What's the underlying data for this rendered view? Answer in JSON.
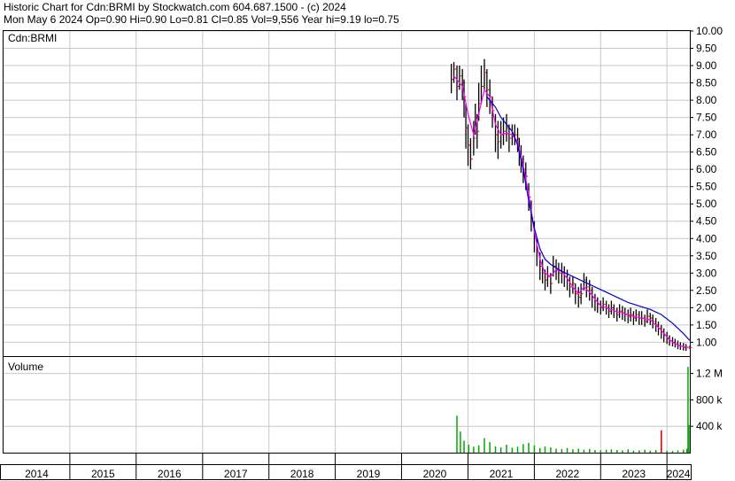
{
  "header": {
    "line1": "Historic Chart for Cdn:BRMI by Stockwatch.com 604.687.1500 - (c) 2024",
    "line2": "Mon May  6 2024  Op=0.90  Hi=0.90  Lo=0.81  Cl=0.85  Vol=9,556  Year hi=9.19  lo=0.75"
  },
  "colors": {
    "price": "#000000",
    "ma_short": "#ff00ff",
    "ma_long": "#0000cc",
    "close_marks": "#ff0000",
    "volume": "#00aa00",
    "volume_spike": "#cc0000",
    "grid": "#c8c8c8"
  },
  "chart_data": [
    {
      "type": "line",
      "title": "Cdn:BRMI",
      "y_tick_labels": [
        "10.00",
        "9.50",
        "9.00",
        "8.50",
        "8.00",
        "7.50",
        "7.00",
        "6.50",
        "6.00",
        "5.50",
        "5.00",
        "4.50",
        "4.00",
        "3.50",
        "3.00",
        "2.50",
        "2.00",
        "1.50",
        "1.00"
      ],
      "ylim": [
        0.6,
        10.0
      ],
      "x_tick_labels": [
        "2014",
        "2015",
        "2016",
        "2017",
        "2018",
        "2019",
        "2020",
        "2021",
        "2022",
        "2023",
        "2024"
      ],
      "xlim": [
        "2014-01-01",
        "2024-05-06"
      ],
      "grid": true,
      "series": [
        {
          "key": "price",
          "x": [
            "2020-10-01",
            "2020-10-15",
            "2020-11-01",
            "2020-11-15",
            "2020-12-01",
            "2020-12-10",
            "2020-12-20",
            "2021-01-01",
            "2021-01-15",
            "2021-02-01",
            "2021-02-10",
            "2021-02-20",
            "2021-03-01",
            "2021-03-15",
            "2021-04-01",
            "2021-04-15",
            "2021-05-01",
            "2021-05-15",
            "2021-06-01",
            "2021-06-15",
            "2021-07-01",
            "2021-07-15",
            "2021-08-01",
            "2021-08-15",
            "2021-09-01",
            "2021-09-15",
            "2021-10-01",
            "2021-10-10",
            "2021-10-20",
            "2021-11-01",
            "2021-11-15",
            "2021-12-01",
            "2021-12-15",
            "2022-01-01",
            "2022-01-15",
            "2022-02-01",
            "2022-02-15",
            "2022-03-01",
            "2022-03-15",
            "2022-04-01",
            "2022-04-15",
            "2022-05-01",
            "2022-05-15",
            "2022-06-01",
            "2022-06-15",
            "2022-07-01",
            "2022-07-15",
            "2022-08-01",
            "2022-08-15",
            "2022-09-01",
            "2022-09-15",
            "2022-10-01",
            "2022-10-15",
            "2022-11-01",
            "2022-11-15",
            "2022-12-01",
            "2022-12-15",
            "2023-01-01",
            "2023-01-15",
            "2023-02-01",
            "2023-02-15",
            "2023-03-01",
            "2023-03-15",
            "2023-04-01",
            "2023-04-15",
            "2023-05-01",
            "2023-05-15",
            "2023-06-01",
            "2023-06-15",
            "2023-07-01",
            "2023-07-15",
            "2023-08-01",
            "2023-08-15",
            "2023-09-01",
            "2023-09-15",
            "2023-10-01",
            "2023-10-15",
            "2023-11-01",
            "2023-11-15",
            "2023-12-01",
            "2023-12-15",
            "2024-01-01",
            "2024-01-15",
            "2024-02-01",
            "2024-02-15",
            "2024-03-01",
            "2024-03-15",
            "2024-04-01",
            "2024-04-15",
            "2024-05-06"
          ],
          "close": [
            8.6,
            8.9,
            8.4,
            8.7,
            8.5,
            8.1,
            7.2,
            6.7,
            6.3,
            6.9,
            7.5,
            7.1,
            7.9,
            8.4,
            8.8,
            8.3,
            8.1,
            7.7,
            7.0,
            6.8,
            7.0,
            7.1,
            7.2,
            6.9,
            7.0,
            7.0,
            6.9,
            6.5,
            6.3,
            6.0,
            5.8,
            5.2,
            4.6,
            4.0,
            3.6,
            3.2,
            3.0,
            2.8,
            2.9,
            2.7,
            3.2,
            3.1,
            3.0,
            3.0,
            2.9,
            2.8,
            2.6,
            2.7,
            2.4,
            2.3,
            2.4,
            2.8,
            2.6,
            2.5,
            2.3,
            2.2,
            2.1,
            2.0,
            2.1,
            2.0,
            1.9,
            2.0,
            1.9,
            1.8,
            1.9,
            1.85,
            1.8,
            1.75,
            1.8,
            1.7,
            1.8,
            1.7,
            1.7,
            1.6,
            1.75,
            1.7,
            1.6,
            1.5,
            1.4,
            1.3,
            1.2,
            1.1,
            1.05,
            1.0,
            0.95,
            0.9,
            0.88,
            0.85,
            0.85,
            0.85
          ],
          "high": [
            9.05,
            9.1,
            9.0,
            9.0,
            8.9,
            8.6,
            7.9,
            7.3,
            6.9,
            7.4,
            7.9,
            7.6,
            8.5,
            9.0,
            9.19,
            8.9,
            8.6,
            8.1,
            7.6,
            7.4,
            7.4,
            7.5,
            7.6,
            7.3,
            7.3,
            7.3,
            7.2,
            6.9,
            6.7,
            6.4,
            6.2,
            5.6,
            5.1,
            4.5,
            4.0,
            3.6,
            3.4,
            3.1,
            3.2,
            3.0,
            3.5,
            3.4,
            3.3,
            3.3,
            3.2,
            3.1,
            2.9,
            2.9,
            2.7,
            2.6,
            2.7,
            3.0,
            2.9,
            2.8,
            2.6,
            2.4,
            2.3,
            2.2,
            2.3,
            2.2,
            2.1,
            2.2,
            2.1,
            2.0,
            2.1,
            2.05,
            2.0,
            1.95,
            2.0,
            1.9,
            1.95,
            1.9,
            1.9,
            1.8,
            1.95,
            1.85,
            1.8,
            1.7,
            1.6,
            1.5,
            1.4,
            1.3,
            1.2,
            1.15,
            1.1,
            1.05,
            1.0,
            0.98,
            0.95,
            0.9
          ],
          "low": [
            8.2,
            8.5,
            8.0,
            8.3,
            8.0,
            7.5,
            6.6,
            6.1,
            6.0,
            6.4,
            7.0,
            6.6,
            7.4,
            7.9,
            8.3,
            7.8,
            7.6,
            7.2,
            6.5,
            6.3,
            6.6,
            6.7,
            6.8,
            6.5,
            6.7,
            6.7,
            6.5,
            6.1,
            5.9,
            5.6,
            5.4,
            4.8,
            4.2,
            3.6,
            3.2,
            2.8,
            2.7,
            2.5,
            2.6,
            2.4,
            2.9,
            2.8,
            2.7,
            2.7,
            2.6,
            2.5,
            2.3,
            2.4,
            2.1,
            2.0,
            2.1,
            2.5,
            2.3,
            2.2,
            2.0,
            1.9,
            1.85,
            1.8,
            1.9,
            1.8,
            1.7,
            1.8,
            1.7,
            1.6,
            1.7,
            1.65,
            1.6,
            1.55,
            1.6,
            1.5,
            1.6,
            1.5,
            1.5,
            1.45,
            1.55,
            1.5,
            1.4,
            1.3,
            1.2,
            1.1,
            1.0,
            0.95,
            0.9,
            0.88,
            0.85,
            0.8,
            0.78,
            0.76,
            0.75,
            0.81
          ]
        },
        {
          "key": "ma_short",
          "x": [
            "2020-10-15",
            "2020-12-01",
            "2021-01-01",
            "2021-02-01",
            "2021-03-01",
            "2021-04-01",
            "2021-05-01",
            "2021-06-01",
            "2021-07-01",
            "2021-08-01",
            "2021-09-01",
            "2021-10-01",
            "2021-11-01",
            "2021-12-01",
            "2022-01-01",
            "2022-02-01",
            "2022-03-01",
            "2022-04-01",
            "2022-05-01",
            "2022-06-01",
            "2022-07-01",
            "2022-08-01",
            "2022-09-01",
            "2022-10-01",
            "2022-11-01",
            "2022-12-01",
            "2023-01-01",
            "2023-02-01",
            "2023-03-01",
            "2023-04-01",
            "2023-05-01",
            "2023-06-01",
            "2023-07-01",
            "2023-08-01",
            "2023-09-01",
            "2023-10-01",
            "2023-11-01",
            "2023-12-01",
            "2024-01-01",
            "2024-02-01",
            "2024-03-01",
            "2024-04-01",
            "2024-05-06"
          ],
          "values": [
            8.7,
            8.4,
            7.6,
            7.0,
            7.6,
            8.3,
            8.1,
            7.3,
            7.0,
            7.05,
            7.0,
            6.8,
            6.1,
            5.3,
            4.2,
            3.4,
            3.0,
            2.9,
            3.1,
            3.05,
            2.85,
            2.6,
            2.4,
            2.6,
            2.45,
            2.25,
            2.05,
            2.0,
            1.95,
            1.88,
            1.85,
            1.8,
            1.75,
            1.72,
            1.68,
            1.65,
            1.5,
            1.35,
            1.15,
            1.0,
            0.92,
            0.87,
            0.85
          ]
        },
        {
          "key": "ma_long",
          "x": [
            "2021-04-15",
            "2021-06-01",
            "2021-07-01",
            "2021-08-01",
            "2021-09-01",
            "2021-10-01",
            "2021-11-01",
            "2021-12-01",
            "2022-01-01",
            "2022-02-01",
            "2022-03-01",
            "2022-04-01",
            "2022-05-01",
            "2022-06-01",
            "2022-08-01",
            "2022-10-01",
            "2022-12-01",
            "2023-02-01",
            "2023-04-01",
            "2023-06-01",
            "2023-08-01",
            "2023-10-01",
            "2023-12-01",
            "2024-02-01",
            "2024-04-01",
            "2024-05-06"
          ],
          "values": [
            8.1,
            7.8,
            7.5,
            7.3,
            7.1,
            6.7,
            6.0,
            5.1,
            4.3,
            3.7,
            3.4,
            3.25,
            3.15,
            3.05,
            2.9,
            2.75,
            2.6,
            2.45,
            2.3,
            2.15,
            2.05,
            1.95,
            1.8,
            1.55,
            1.25,
            1.05
          ]
        }
      ]
    },
    {
      "type": "bar",
      "title": "Volume",
      "y_tick_labels": [
        "1.2 M",
        "800 k",
        "400 k"
      ],
      "y_ticks": [
        1200000,
        800000,
        400000
      ],
      "ylim": [
        0,
        1450000
      ],
      "x_tick_labels": [
        "2014",
        "2015",
        "2016",
        "2017",
        "2018",
        "2019",
        "2020",
        "2021",
        "2022",
        "2023",
        "2024"
      ],
      "series": [
        {
          "key": "volume",
          "x": [
            "2020-11-01",
            "2020-11-20",
            "2020-12-10",
            "2021-01-05",
            "2021-02-01",
            "2021-03-01",
            "2021-04-01",
            "2021-05-01",
            "2021-06-01",
            "2021-07-01",
            "2021-08-01",
            "2021-09-01",
            "2021-10-01",
            "2021-11-01",
            "2021-12-01",
            "2022-01-01",
            "2022-02-01",
            "2022-03-01",
            "2022-04-01",
            "2022-05-01",
            "2022-06-01",
            "2022-07-01",
            "2022-08-01",
            "2022-09-01",
            "2022-10-01",
            "2022-11-01",
            "2022-12-01",
            "2023-01-01",
            "2023-02-01",
            "2023-03-01",
            "2023-04-01",
            "2023-05-01",
            "2023-06-01",
            "2023-07-01",
            "2023-08-01",
            "2023-09-01",
            "2023-10-01",
            "2023-11-01",
            "2023-12-01",
            "2024-01-01",
            "2024-02-01",
            "2024-03-01",
            "2024-04-01",
            "2024-04-20",
            "2024-04-26",
            "2024-05-01",
            "2024-05-06"
          ],
          "values": [
            560000,
            320000,
            180000,
            120000,
            90000,
            110000,
            220000,
            160000,
            95000,
            80000,
            120000,
            75000,
            90000,
            130000,
            150000,
            110000,
            70000,
            95000,
            80000,
            60000,
            55000,
            70000,
            50000,
            60000,
            45000,
            55000,
            40000,
            35000,
            45000,
            50000,
            40000,
            35000,
            50000,
            30000,
            35000,
            45000,
            30000,
            40000,
            340000,
            30000,
            25000,
            35000,
            45000,
            60000,
            1300000,
            420000,
            9556
          ]
        }
      ]
    }
  ]
}
